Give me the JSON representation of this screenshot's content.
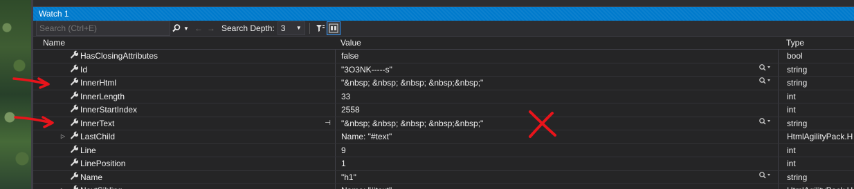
{
  "window": {
    "title": "Watch 1"
  },
  "toolbar": {
    "search_placeholder": "Search (Ctrl+E)",
    "search_depth_label": "Search Depth:",
    "search_depth_value": "3"
  },
  "columns": {
    "name": "Name",
    "value": "Value",
    "type": "Type"
  },
  "rows": [
    {
      "name": "HasClosingAttributes",
      "value": "false",
      "type": "bool",
      "expandable": false,
      "visualizer": false,
      "pinned": false
    },
    {
      "name": "Id",
      "value": "\"3O3NK-----s\"",
      "type": "string",
      "expandable": false,
      "visualizer": true,
      "pinned": false
    },
    {
      "name": "InnerHtml",
      "value": "\"&nbsp; &nbsp; &nbsp; &nbsp;&nbsp;\"",
      "type": "string",
      "expandable": false,
      "visualizer": true,
      "pinned": false
    },
    {
      "name": "InnerLength",
      "value": "33",
      "type": "int",
      "expandable": false,
      "visualizer": false,
      "pinned": false
    },
    {
      "name": "InnerStartIndex",
      "value": "2558",
      "type": "int",
      "expandable": false,
      "visualizer": false,
      "pinned": false
    },
    {
      "name": "InnerText",
      "value": "\"&nbsp; &nbsp; &nbsp; &nbsp;&nbsp;\"",
      "type": "string",
      "expandable": false,
      "visualizer": true,
      "pinned": true
    },
    {
      "name": "LastChild",
      "value": "Name: \"#text\"",
      "type": "HtmlAgilityPack.H",
      "expandable": true,
      "visualizer": false,
      "pinned": false
    },
    {
      "name": "Line",
      "value": "9",
      "type": "int",
      "expandable": false,
      "visualizer": false,
      "pinned": false
    },
    {
      "name": "LinePosition",
      "value": "1",
      "type": "int",
      "expandable": false,
      "visualizer": false,
      "pinned": false
    },
    {
      "name": "Name",
      "value": "\"h1\"",
      "type": "string",
      "expandable": false,
      "visualizer": true,
      "pinned": false
    },
    {
      "name": "NextSibling",
      "value": "Name: \"#text\"",
      "type": "HtmlAgilityPack.H",
      "expandable": true,
      "visualizer": false,
      "pinned": false
    }
  ],
  "colors": {
    "title_bar": "#007acc",
    "panel_bg": "#252526",
    "annotation_red": "#e8141b"
  },
  "icons": {
    "property": "wrench-icon",
    "expander": "triangle-right-icon",
    "visualizer": "magnifier-icon",
    "pin": "pin-icon"
  }
}
